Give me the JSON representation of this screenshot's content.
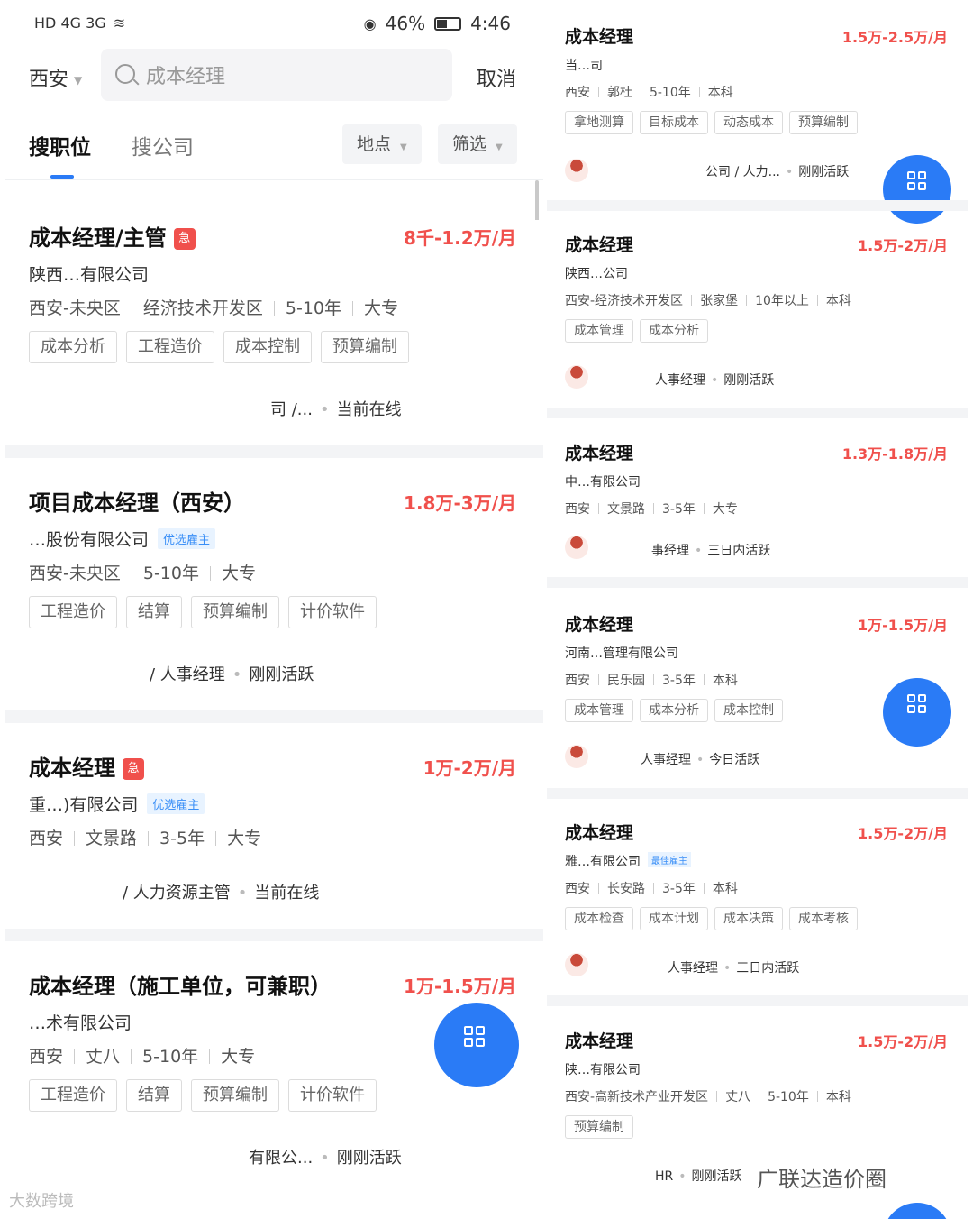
{
  "status_bar": {
    "left": "HD 4G 3G",
    "battery": "46%",
    "time": "4:46"
  },
  "search": {
    "city": "西安",
    "query": "成本经理",
    "cancel": "取消"
  },
  "tabs": {
    "active": "搜职位",
    "inactive": "搜公司",
    "filter_location": "地点",
    "filter_more": "筛选"
  },
  "left_jobs": [
    {
      "title": "成本经理/主管",
      "urgent": "急",
      "salary": "8千-1.2万/月",
      "company": "陕西…有限公司",
      "meta": [
        "西安-未央区",
        "经济技术开发区",
        "5-10年",
        "大专"
      ],
      "tags": [
        "成本分析",
        "工程造价",
        "成本控制",
        "预算编制"
      ],
      "recruiter": "司 /...",
      "activity": "当前在线"
    },
    {
      "title": "项目成本经理（西安）",
      "salary": "1.8万-3万/月",
      "company": "…股份有限公司",
      "badge": "优选雇主",
      "meta": [
        "西安-未央区",
        "5-10年",
        "大专"
      ],
      "tags": [
        "工程造价",
        "结算",
        "预算编制",
        "计价软件"
      ],
      "recruiter": "/ 人事经理",
      "activity": "刚刚活跃"
    },
    {
      "title": "成本经理",
      "urgent": "急",
      "salary": "1万-2万/月",
      "company": "重…)有限公司",
      "badge": "优选雇主",
      "meta": [
        "西安",
        "文景路",
        "3-5年",
        "大专"
      ],
      "tags": [],
      "recruiter": "/ 人力资源主管",
      "activity": "当前在线"
    },
    {
      "title": "成本经理（施工单位，可兼职）",
      "salary": "1万-1.5万/月",
      "company": "…术有限公司",
      "meta": [
        "西安",
        "丈八",
        "5-10年",
        "大专"
      ],
      "tags": [
        "工程造价",
        "结算",
        "预算编制",
        "计价软件"
      ],
      "recruiter": "有限公...",
      "activity": "刚刚活跃"
    }
  ],
  "right_jobs": [
    {
      "title": "成本经理",
      "salary": "1.5万-2.5万/月",
      "company": "当…司",
      "meta": [
        "西安",
        "郭杜",
        "5-10年",
        "本科"
      ],
      "tags": [
        "拿地测算",
        "目标成本",
        "动态成本",
        "预算编制"
      ],
      "recruiter": "公司 / 人力...",
      "activity": "刚刚活跃"
    },
    {
      "title": "成本经理",
      "salary": "1.5万-2万/月",
      "company": "陕西…公司",
      "meta": [
        "西安-经济技术开发区",
        "张家堡",
        "10年以上",
        "本科"
      ],
      "tags": [
        "成本管理",
        "成本分析"
      ],
      "recruiter": "人事经理",
      "activity": "刚刚活跃"
    },
    {
      "title": "成本经理",
      "salary": "1.3万-1.8万/月",
      "company": "中…有限公司",
      "meta": [
        "西安",
        "文景路",
        "3-5年",
        "大专"
      ],
      "tags": [],
      "recruiter": "事经理",
      "activity": "三日内活跃"
    },
    {
      "title": "成本经理",
      "salary": "1万-1.5万/月",
      "company": "河南…管理有限公司",
      "meta": [
        "西安",
        "民乐园",
        "3-5年",
        "本科"
      ],
      "tags": [
        "成本管理",
        "成本分析",
        "成本控制"
      ],
      "recruiter": "人事经理",
      "activity": "今日活跃"
    },
    {
      "title": "成本经理",
      "salary": "1.5万-2万/月",
      "company": "雅…有限公司",
      "badge": "最佳雇主",
      "meta": [
        "西安",
        "长安路",
        "3-5年",
        "本科"
      ],
      "tags": [
        "成本检查",
        "成本计划",
        "成本决策",
        "成本考核"
      ],
      "recruiter": "人事经理",
      "activity": "三日内活跃"
    },
    {
      "title": "成本经理",
      "salary": "1.5万-2万/月",
      "company": "陕…有限公司",
      "meta": [
        "西安-高新技术产业开发区",
        "丈八",
        "5-10年",
        "本科"
      ],
      "tags": [
        "预算编制"
      ],
      "recruiter": "HR",
      "activity": "刚刚活跃"
    }
  ],
  "watermarks": {
    "left": "大数跨境",
    "right": "广联达造价圈"
  },
  "colors": {
    "salary": "#f0504c",
    "accent": "#2a7bf6",
    "badge_bg": "#e8f3ff"
  },
  "icons": [
    "search-icon",
    "grid-icon",
    "chevron-down-icon",
    "battery-icon",
    "wifi-icon",
    "signal-icon"
  ]
}
